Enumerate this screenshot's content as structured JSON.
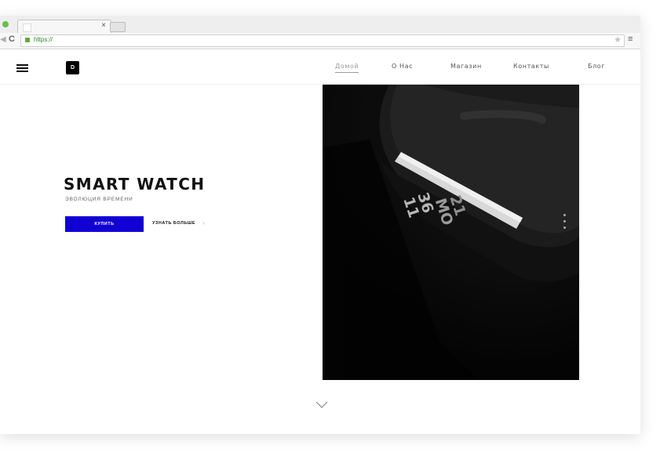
{
  "browser": {
    "url": "https://",
    "tab_close": "×",
    "back_icon": "arrow-left-icon",
    "reload_icon": "reload-icon",
    "lock_icon": "lock-icon",
    "star_icon": "star-icon",
    "menu_icon": "hamburger-menu-icon",
    "reload_glyph": "C",
    "star_glyph": "★",
    "menu_glyph": "≡"
  },
  "header": {
    "logo_text": "D",
    "nav": [
      {
        "label": "Домой",
        "active": true
      },
      {
        "label": "О Нас",
        "active": false
      },
      {
        "label": "Магазин",
        "active": false
      },
      {
        "label": "Контакты",
        "active": false
      },
      {
        "label": "Блог",
        "active": false
      }
    ]
  },
  "hero": {
    "title": "SMART WATCH",
    "subtitle": "ЭВОЛЮЦИЯ ВРЕМЕНИ",
    "buy_label": "КУПИТЬ",
    "more_label": "УЗНАТЬ БОЛЬШЕ",
    "more_arrow": "›",
    "image_watch_display": [
      "11",
      "36",
      "MO",
      "21"
    ]
  },
  "colors": {
    "accent": "#1100d4",
    "photo_bg": "#050505",
    "status_green": "#5fc348"
  }
}
